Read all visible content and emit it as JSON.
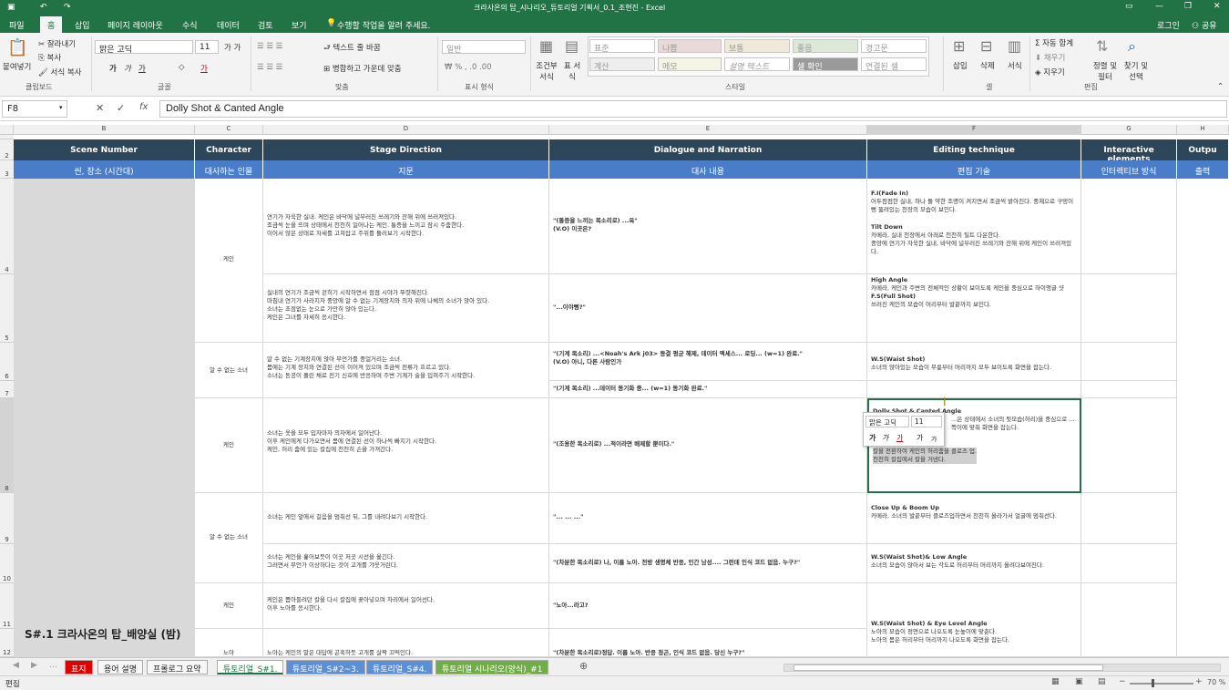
{
  "window": {
    "title": "크라사온의 탑_시나리오_튜토리얼 기획서_0.1_조현진 - Excel"
  },
  "tabs": [
    "파일",
    "홈",
    "삽입",
    "페이지 레이아웃",
    "수식",
    "데이터",
    "검토",
    "보기"
  ],
  "tell_me": "수행할 작업을 알려 주세요.",
  "account": {
    "login": "로그인",
    "share": "공유"
  },
  "ribbon": {
    "clipboard": {
      "paste": "붙여넣기",
      "cut": "잘라내기",
      "copy": "복사",
      "format_painter": "서식 복사",
      "group": "클립보드"
    },
    "font": {
      "name": "맑은 고딕",
      "size": "11",
      "group": "글꼴"
    },
    "align": {
      "wrap": "텍스트 줄 바꿈",
      "merge": "병합하고 가운데 맞춤",
      "group": "맞춤"
    },
    "number": {
      "format": "일반",
      "group": "표시 형식"
    },
    "styles": {
      "cond": "조건부 서식",
      "table": "표 서식",
      "items": [
        "표준",
        "나쁨",
        "보통",
        "좋음",
        "경고문",
        "계산",
        "메모",
        "설명 텍스트",
        "셀 확인",
        "연결된 셀"
      ],
      "group": "스타일"
    },
    "cells": {
      "insert": "삽입",
      "delete": "삭제",
      "format": "서식",
      "group": "셀"
    },
    "editing": {
      "autosum": "자동 합계",
      "fill": "채우기",
      "clear": "지우기",
      "sort": "정렬 및 필터",
      "find": "찾기 및 선택",
      "group": "편집"
    }
  },
  "formula": {
    "namebox": "F8",
    "content": "Dolly Shot & Canted Angle"
  },
  "columns": [
    "B",
    "C",
    "D",
    "E",
    "F",
    "G",
    "H"
  ],
  "rows": [
    "2",
    "3",
    "4",
    "5",
    "6",
    "7",
    "8",
    "9",
    "10",
    "11",
    "12"
  ],
  "header1": [
    "Scene Number",
    "Character",
    "Stage Direction",
    "Dialogue and Narration",
    "Editing technique",
    "Interactive elements",
    "Outpu"
  ],
  "header2": [
    "씬, 장소 (시간대)",
    "대사하는 인물",
    "지문",
    "대사 내용",
    "편집 기술",
    "인터렉티브 방식",
    "출력"
  ],
  "scene_title": "S#.1 크라사온의 탑_배양실 (밤)",
  "char": {
    "r4": "케인",
    "r6": "알 수 없는 소녀",
    "r8": "케인",
    "r9": "알 수 없는 소녀",
    "r11": "케인",
    "r12": "노아"
  },
  "stage": {
    "r4": "연기가 자욱한 실내. 케인은 바닥에 널부러진 쓰레기와 잔해 위에 쓰러져있다.\n조금씩 눈을 뜨며 상태에서 천천히 일어나는 케인. 통증을 느끼고 잠시 주춤한다.\n이어서 앉은 상태로 자세를 고쳐잡고 주위를 둘러보기 시작한다.",
    "r5": "실내의 연기가 조금씩 걷히기 시작하면서 점점 시야가 뚜렷해진다.\n마침내 연기가 사라지자 중앙에 알 수 없는 기계장치와 의자 위에 나체의 소녀가 앉아 있다.\n소녀는 초점없는 눈으로 가만히 앉아 있는다.\n케인은 그녀를 자세히 응시한다.",
    "r6": "알 수 없는 기계장치에 앉아 무언가를 중얼거리는 소녀.\n몸에는 기계 장치와 연결된 선이 이어져 있으며 조금씩 전류가 흐르고 있다.\n소녀는 동공이 풀린 채로 전기 신호에 반응하며 주변 기계가 술을 입혀주기 시작한다.",
    "r8": "소녀는 옷을 모두 입자마자 의자에서 일어난다.\n이후 케인에게 다가오면서 몸에 연결된 선이 하나씩 빠지기 시작한다.\n케인, 허리 춤에 있는 칼집에 천천히 손을 가져간다.",
    "r9": "소녀는 케인 앞에서 걸음을 멈춰선 뒤, 그를 내려다보기 시작한다.",
    "r10": "소녀는 케인을 훑어보듯이 이곳 저곳 시선을 옮긴다.\n그러면서 무언가 이상하다는 것이 고개를 갸웃거린다.",
    "r11": "케인은 뽑아들려던 칼을 다시 칼집에 꽂아넣으며 자리에서 일어선다.\n이후 노아를 응시한다.",
    "r12": "노아는 케인의 말은 대답에 곤혹하듯 고개를 살짝 끄떡인다."
  },
  "dialogue": {
    "r4": "\"(통증을 느끼는 목소리로) ...윽\"\n(V.O) 이곳은?",
    "r5": "\"...이야뻥?\"",
    "r6": "\"(기계 목소리) ...<Noah's Ark j03> 동결 펑균 해제, 데이터 엑세스... 로딩... (w=1) 완료.\"\n(V.O) 아니, 다른 사람인가",
    "r7": "\"(기계 목소리) ...데이터 동기화 중... (w=1) 동기화 완료.\"",
    "r8": "\"(조용한 목소리로) ...적이라면 배제할 뿐이다.\"",
    "r9": "\"... ... ...\"",
    "r10": "\"(차분한 목소리로) 나, 이름 노아. 전방 생명체 반응, 인간 남성.... 그런데 인식 코드 없음. 누구?\"",
    "r11": "\"노아...라고?",
    "r12": "\"(차분한 목소리로)정답. 이름 노아. 반응 정곤, 인식 코드 없음. 당신 누구?\""
  },
  "edit": {
    "r4a": "F.I(Fade In)",
    "r4b": "어두컴컴한 실내, 하나 둘 약한 조명이 켜지면서 조금씩 밝아진다. 중제으로 구멍이 뻥 뚫려있는 천장의 모습이 보인다.",
    "r4c": "Tilt Down",
    "r4d": "카메라, 실내 천장에서 아래로 천천히 틸트 다운한다.\n중앙에 연기가 자욱한 실내, 바닥에 널부러진 쓰레기와 잔해 위에 케인이 쓰러져있다.",
    "r5a": "High Angle",
    "r5b": "카메라, 케인과 주변의 전체적인 상황이 보이도록 케인을 중심으로 하이앵글 샷",
    "r5c": "F.S(Full Shot)",
    "r5d": "쓰러진 케인의 모습이 머리부터 발끝까지 보인다.",
    "r6a": "W.S(Waist Shot)",
    "r6b": "소녀의 앉아있는 모습이 무릎부터 머리까지 모두 보이도록 화면을 잡는다.",
    "r8a": "Dolly Shot & Canted Angle",
    "r8b": "...은 상태에서 소녀의 뒷모습(허리)을 중심으로 ...쪽이에 맞춰 화면을 잡는다.",
    "r8c": "C.U(Close Up)",
    "r8d": "칼을 전환하여 케인의 허리춤을 클로즈 업.\n천천히 칼집에서 칼을 거낸다.",
    "r9a": "Close Up & Boom Up",
    "r9b": "카메라, 소녀의 발끝부터 클로즈업하면서 천천히 올라가서 얼굴에 멈춰선다.",
    "r10a": "W.S(Waist Shot)& Low Angle",
    "r10b": "소녀의 모습이 앉아서 보는 각도로 허리부터 머리까지 올려다보여진다.",
    "r11a": "W.S(Waist Shot) & Eye Level Angle",
    "r11b": "노아의 모습이 정면으로 나오도록 눈높이에 맞춘다.\n노아의 몸은 허리부터 머리까지 나오도록 화면을 잡는다."
  },
  "mini": {
    "font": "맑은 고딕",
    "size": "11"
  },
  "sheets": [
    "표지",
    "용어 설명",
    "프롤로그 요약",
    "튜토리얼_S#1.",
    "튜토리얼_S#2~3.",
    "튜토리얼_S#4.",
    "튜토리얼 시나리오(양식)_#1"
  ],
  "status": {
    "mode": "편집",
    "zoom": "70 %"
  },
  "colors": {
    "excel": "#217346",
    "hdr_dark": "#2d4659",
    "hdr_blue": "#4a7dc9"
  }
}
